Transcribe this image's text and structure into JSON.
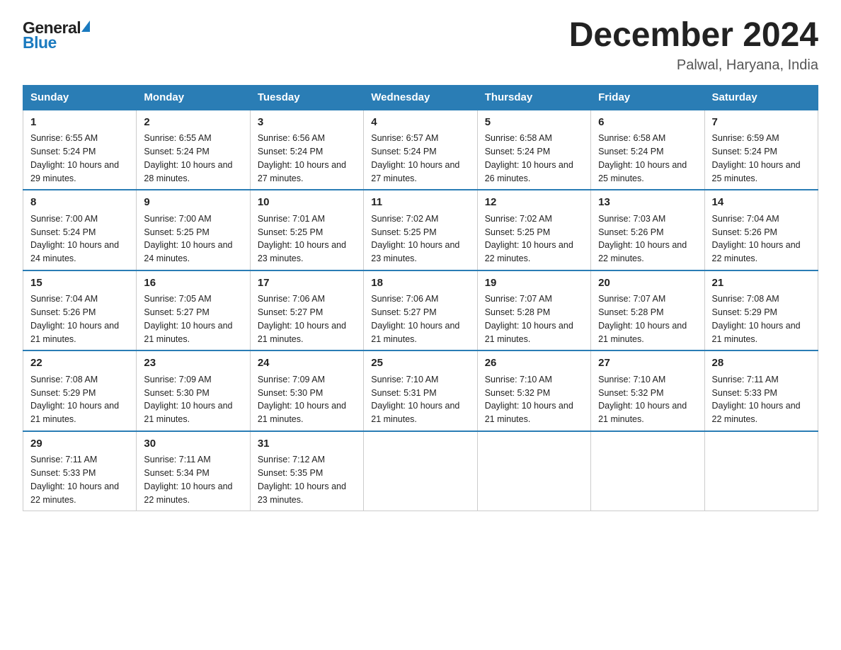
{
  "logo": {
    "line1": "General",
    "line2": "Blue"
  },
  "title": "December 2024",
  "subtitle": "Palwal, Haryana, India",
  "days": [
    "Sunday",
    "Monday",
    "Tuesday",
    "Wednesday",
    "Thursday",
    "Friday",
    "Saturday"
  ],
  "weeks": [
    [
      {
        "num": "1",
        "sunrise": "6:55 AM",
        "sunset": "5:24 PM",
        "daylight": "10 hours and 29 minutes."
      },
      {
        "num": "2",
        "sunrise": "6:55 AM",
        "sunset": "5:24 PM",
        "daylight": "10 hours and 28 minutes."
      },
      {
        "num": "3",
        "sunrise": "6:56 AM",
        "sunset": "5:24 PM",
        "daylight": "10 hours and 27 minutes."
      },
      {
        "num": "4",
        "sunrise": "6:57 AM",
        "sunset": "5:24 PM",
        "daylight": "10 hours and 27 minutes."
      },
      {
        "num": "5",
        "sunrise": "6:58 AM",
        "sunset": "5:24 PM",
        "daylight": "10 hours and 26 minutes."
      },
      {
        "num": "6",
        "sunrise": "6:58 AM",
        "sunset": "5:24 PM",
        "daylight": "10 hours and 25 minutes."
      },
      {
        "num": "7",
        "sunrise": "6:59 AM",
        "sunset": "5:24 PM",
        "daylight": "10 hours and 25 minutes."
      }
    ],
    [
      {
        "num": "8",
        "sunrise": "7:00 AM",
        "sunset": "5:24 PM",
        "daylight": "10 hours and 24 minutes."
      },
      {
        "num": "9",
        "sunrise": "7:00 AM",
        "sunset": "5:25 PM",
        "daylight": "10 hours and 24 minutes."
      },
      {
        "num": "10",
        "sunrise": "7:01 AM",
        "sunset": "5:25 PM",
        "daylight": "10 hours and 23 minutes."
      },
      {
        "num": "11",
        "sunrise": "7:02 AM",
        "sunset": "5:25 PM",
        "daylight": "10 hours and 23 minutes."
      },
      {
        "num": "12",
        "sunrise": "7:02 AM",
        "sunset": "5:25 PM",
        "daylight": "10 hours and 22 minutes."
      },
      {
        "num": "13",
        "sunrise": "7:03 AM",
        "sunset": "5:26 PM",
        "daylight": "10 hours and 22 minutes."
      },
      {
        "num": "14",
        "sunrise": "7:04 AM",
        "sunset": "5:26 PM",
        "daylight": "10 hours and 22 minutes."
      }
    ],
    [
      {
        "num": "15",
        "sunrise": "7:04 AM",
        "sunset": "5:26 PM",
        "daylight": "10 hours and 21 minutes."
      },
      {
        "num": "16",
        "sunrise": "7:05 AM",
        "sunset": "5:27 PM",
        "daylight": "10 hours and 21 minutes."
      },
      {
        "num": "17",
        "sunrise": "7:06 AM",
        "sunset": "5:27 PM",
        "daylight": "10 hours and 21 minutes."
      },
      {
        "num": "18",
        "sunrise": "7:06 AM",
        "sunset": "5:27 PM",
        "daylight": "10 hours and 21 minutes."
      },
      {
        "num": "19",
        "sunrise": "7:07 AM",
        "sunset": "5:28 PM",
        "daylight": "10 hours and 21 minutes."
      },
      {
        "num": "20",
        "sunrise": "7:07 AM",
        "sunset": "5:28 PM",
        "daylight": "10 hours and 21 minutes."
      },
      {
        "num": "21",
        "sunrise": "7:08 AM",
        "sunset": "5:29 PM",
        "daylight": "10 hours and 21 minutes."
      }
    ],
    [
      {
        "num": "22",
        "sunrise": "7:08 AM",
        "sunset": "5:29 PM",
        "daylight": "10 hours and 21 minutes."
      },
      {
        "num": "23",
        "sunrise": "7:09 AM",
        "sunset": "5:30 PM",
        "daylight": "10 hours and 21 minutes."
      },
      {
        "num": "24",
        "sunrise": "7:09 AM",
        "sunset": "5:30 PM",
        "daylight": "10 hours and 21 minutes."
      },
      {
        "num": "25",
        "sunrise": "7:10 AM",
        "sunset": "5:31 PM",
        "daylight": "10 hours and 21 minutes."
      },
      {
        "num": "26",
        "sunrise": "7:10 AM",
        "sunset": "5:32 PM",
        "daylight": "10 hours and 21 minutes."
      },
      {
        "num": "27",
        "sunrise": "7:10 AM",
        "sunset": "5:32 PM",
        "daylight": "10 hours and 21 minutes."
      },
      {
        "num": "28",
        "sunrise": "7:11 AM",
        "sunset": "5:33 PM",
        "daylight": "10 hours and 22 minutes."
      }
    ],
    [
      {
        "num": "29",
        "sunrise": "7:11 AM",
        "sunset": "5:33 PM",
        "daylight": "10 hours and 22 minutes."
      },
      {
        "num": "30",
        "sunrise": "7:11 AM",
        "sunset": "5:34 PM",
        "daylight": "10 hours and 22 minutes."
      },
      {
        "num": "31",
        "sunrise": "7:12 AM",
        "sunset": "5:35 PM",
        "daylight": "10 hours and 23 minutes."
      },
      {
        "num": "",
        "sunrise": "",
        "sunset": "",
        "daylight": ""
      },
      {
        "num": "",
        "sunrise": "",
        "sunset": "",
        "daylight": ""
      },
      {
        "num": "",
        "sunrise": "",
        "sunset": "",
        "daylight": ""
      },
      {
        "num": "",
        "sunrise": "",
        "sunset": "",
        "daylight": ""
      }
    ]
  ],
  "labels": {
    "sunrise": "Sunrise:",
    "sunset": "Sunset:",
    "daylight": "Daylight:"
  }
}
